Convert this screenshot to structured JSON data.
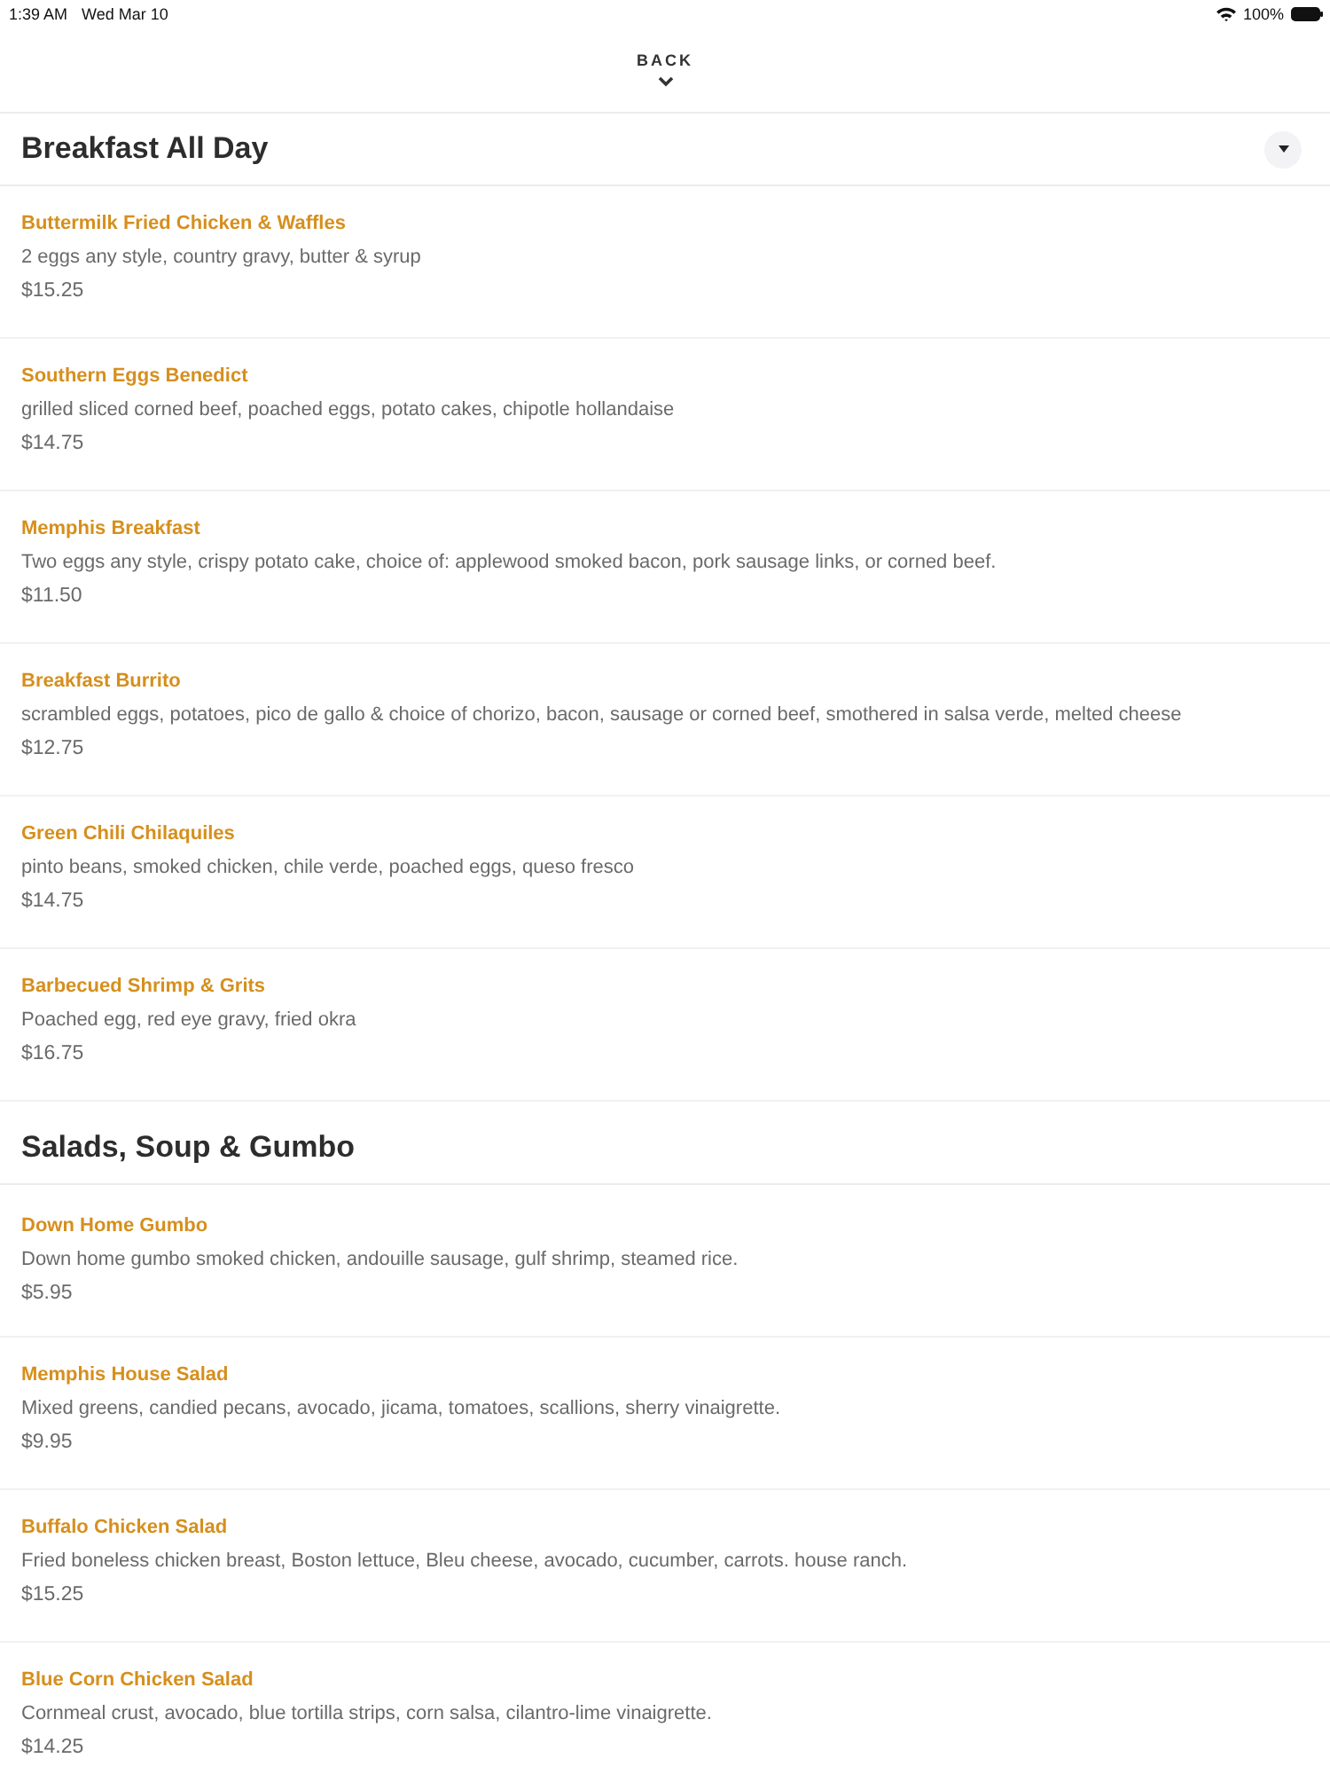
{
  "status_bar": {
    "time": "1:39 AM",
    "date": "Wed Mar 10",
    "battery": "100%"
  },
  "header": {
    "back": "BACK"
  },
  "sections": [
    {
      "kind": "dropdown",
      "title": "Breakfast All Day",
      "items": [
        {
          "name": "Buttermilk Fried Chicken & Waffles",
          "description": "2 eggs any style, country gravy, butter & syrup",
          "price": "$15.25"
        },
        {
          "name": "Southern Eggs Benedict",
          "description": "grilled sliced corned beef, poached eggs, potato cakes, chipotle hollandaise",
          "price": "$14.75"
        },
        {
          "name": "Memphis Breakfast",
          "description": "Two eggs any style, crispy potato cake, choice of: applewood smoked bacon, pork sausage links, or corned beef.",
          "price": "$11.50"
        },
        {
          "name": "Breakfast Burrito",
          "description": "scrambled eggs, potatoes, pico de gallo & choice of chorizo, bacon, sausage or corned beef, smothered in salsa verde, melted cheese",
          "price": "$12.75"
        },
        {
          "name": "Green Chili Chilaquiles",
          "description": "pinto beans, smoked chicken, chile verde, poached eggs, queso fresco",
          "price": "$14.75"
        },
        {
          "name": "Barbecued Shrimp & Grits",
          "description": "Poached egg, red eye gravy, fried okra",
          "price": "$16.75"
        }
      ]
    },
    {
      "kind": "plain",
      "title": "Salads, Soup & Gumbo",
      "items": [
        {
          "name": "Down Home Gumbo",
          "description": "Down home gumbo smoked chicken, andouille sausage, gulf shrimp, steamed rice.",
          "price": "$5.95"
        },
        {
          "name": "Memphis House Salad",
          "description": "Mixed greens, candied pecans, avocado, jicama, tomatoes, scallions, sherry vinaigrette.",
          "price": "$9.95"
        },
        {
          "name": "Buffalo Chicken Salad",
          "description": "Fried boneless chicken breast, Boston lettuce, Bleu cheese, avocado, cucumber, carrots. house ranch.",
          "price": "$15.25"
        },
        {
          "name": "Blue Corn Chicken Salad",
          "description": "Cornmeal crust, avocado, blue tortilla strips, corn salsa, cilantro-lime vinaigrette.",
          "price": "$14.25"
        }
      ]
    }
  ]
}
